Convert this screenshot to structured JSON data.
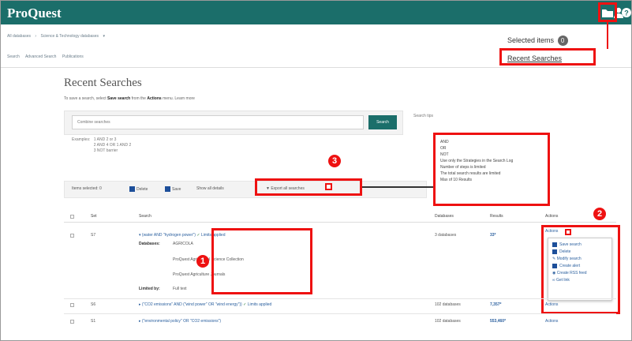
{
  "header": {
    "logo": "ProQuest",
    "icons": [
      "folder-icon",
      "user-icon",
      "help-icon"
    ],
    "accent": "#1b6e6a"
  },
  "breadcrumb": [
    "All databases",
    "Science & Technology databases"
  ],
  "selected_items": {
    "label": "Selected items",
    "count": "0"
  },
  "subnav": [
    "Search",
    "Advanced Search",
    "Publications"
  ],
  "recent_searches_link": "Recent Searches",
  "page": {
    "title": "Recent Searches",
    "intro_prefix": "To save a search, select",
    "intro_bold1": "Save search",
    "intro_mid": "from the",
    "intro_bold2": "Actions",
    "intro_suffix": "menu. Learn more"
  },
  "search": {
    "placeholder": "Combine searches",
    "button": "Search",
    "examples_label": "Examples:",
    "examples": [
      "1 AND 2 or 3",
      "2 AND 4 OR 1 AND 2",
      "3 NOT barrier"
    ],
    "tips_label": "Search tips"
  },
  "tips_popup": {
    "lines": [
      "AND",
      "OR",
      "NOT",
      "Use only the Strategies in the Search Log",
      "Number of steps is limited",
      "The total search results are limited",
      "Max of 10 Results"
    ]
  },
  "toolbar": {
    "items_selected": "Items selected: 0",
    "delete": "Delete",
    "save": "Save",
    "show_details": "Show all details",
    "export": "Export all searches"
  },
  "badges": {
    "one": "1",
    "two": "2",
    "three": "3"
  },
  "table": {
    "headers": [
      "Set",
      "Search",
      "Databases",
      "Results",
      "Actions"
    ],
    "rows": [
      {
        "set": "S7",
        "query": "(water AND \"hydrogen power\")",
        "limits": "Limits applied",
        "databases_label": "Databases:",
        "databases": [
          "AGRICOLA",
          "ProQuest Agricultural Science Collection",
          "ProQuest Agriculture Journals"
        ],
        "limited_label": "Limited by:",
        "limited": "Full text",
        "db_count": "3 databases",
        "results": "33*",
        "actions": "Actions"
      },
      {
        "set": "S6",
        "query": "(\"CO2 emissions\" AND (\"wind power\" OR \"wind energy\"))",
        "limits": "Limits applied",
        "db_count": "102 databases",
        "results": "7,357*",
        "actions": "Actions"
      },
      {
        "set": "S1",
        "query": "(\"environmental policy\" OR \"CO2 emissions\")",
        "db_count": "102 databases",
        "results": "553,460*",
        "actions": "Actions"
      }
    ]
  },
  "action_menu": [
    "Save search",
    "Delete",
    "Modify search",
    "Create alert",
    "Create RSS feed",
    "Get link"
  ]
}
